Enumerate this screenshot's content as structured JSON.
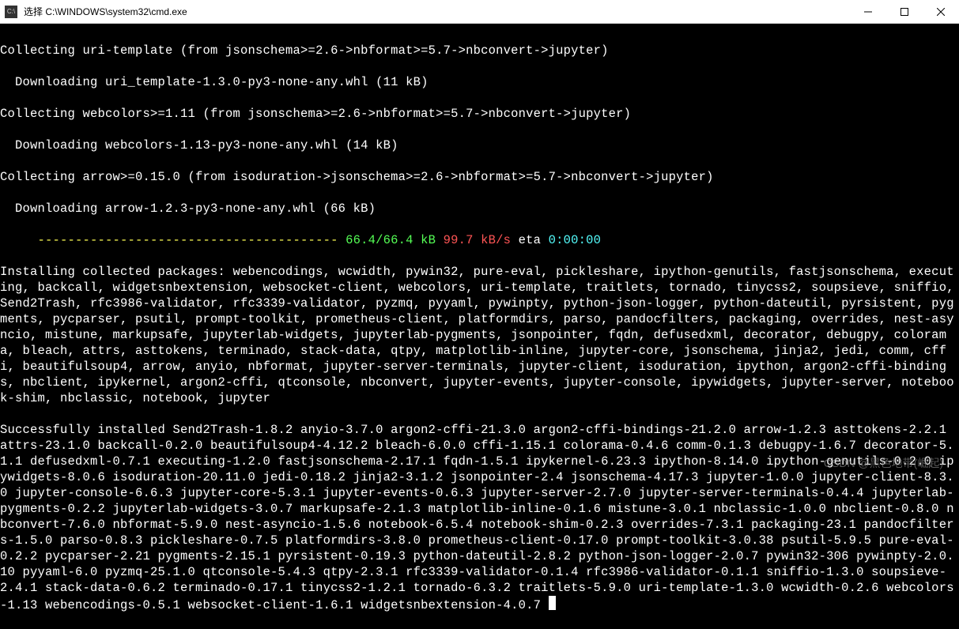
{
  "window": {
    "title": "选择 C:\\WINDOWS\\system32\\cmd.exe",
    "icon_label": "cmd"
  },
  "lines": {
    "l1": "Collecting uri-template (from jsonschema>=2.6->nbformat>=5.7->nbconvert->jupyter)",
    "l2": "  Downloading uri_template-1.3.0-py3-none-any.whl (11 kB)",
    "l3": "Collecting webcolors>=1.11 (from jsonschema>=2.6->nbformat>=5.7->nbconvert->jupyter)",
    "l4": "  Downloading webcolors-1.13-py3-none-any.whl (14 kB)",
    "l5": "Collecting arrow>=0.15.0 (from isoduration->jsonschema>=2.6->nbformat>=5.7->nbconvert->jupyter)",
    "l6": "  Downloading arrow-1.2.3-py3-none-any.whl (66 kB)",
    "progress": {
      "dashes": "     ---------------------------------------- ",
      "size": "66.4/66.4 kB",
      "speed": " 99.7 kB/s",
      "eta_label": " eta ",
      "eta_value": "0:00:00"
    },
    "install": "Installing collected packages: webencodings, wcwidth, pywin32, pure-eval, pickleshare, ipython-genutils, fastjsonschema, executing, backcall, widgetsnbextension, websocket-client, webcolors, uri-template, traitlets, tornado, tinycss2, soupsieve, sniffio, Send2Trash, rfc3986-validator, rfc3339-validator, pyzmq, pyyaml, pywinpty, python-json-logger, python-dateutil, pyrsistent, pygments, pycparser, psutil, prompt-toolkit, prometheus-client, platformdirs, parso, pandocfilters, packaging, overrides, nest-asyncio, mistune, markupsafe, jupyterlab-widgets, jupyterlab-pygments, jsonpointer, fqdn, defusedxml, decorator, debugpy, colorama, bleach, attrs, asttokens, terminado, stack-data, qtpy, matplotlib-inline, jupyter-core, jsonschema, jinja2, jedi, comm, cffi, beautifulsoup4, arrow, anyio, nbformat, jupyter-server-terminals, jupyter-client, isoduration, ipython, argon2-cffi-bindings, nbclient, ipykernel, argon2-cffi, qtconsole, nbconvert, jupyter-events, jupyter-console, ipywidgets, jupyter-server, notebook-shim, nbclassic, notebook, jupyter",
    "success": "Successfully installed Send2Trash-1.8.2 anyio-3.7.0 argon2-cffi-21.3.0 argon2-cffi-bindings-21.2.0 arrow-1.2.3 asttokens-2.2.1 attrs-23.1.0 backcall-0.2.0 beautifulsoup4-4.12.2 bleach-6.0.0 cffi-1.15.1 colorama-0.4.6 comm-0.1.3 debugpy-1.6.7 decorator-5.1.1 defusedxml-0.7.1 executing-1.2.0 fastjsonschema-2.17.1 fqdn-1.5.1 ipykernel-6.23.3 ipython-8.14.0 ipython-genutils-0.2.0 ipywidgets-8.0.6 isoduration-20.11.0 jedi-0.18.2 jinja2-3.1.2 jsonpointer-2.4 jsonschema-4.17.3 jupyter-1.0.0 jupyter-client-8.3.0 jupyter-console-6.6.3 jupyter-core-5.3.1 jupyter-events-0.6.3 jupyter-server-2.7.0 jupyter-server-terminals-0.4.4 jupyterlab-pygments-0.2.2 jupyterlab-widgets-3.0.7 markupsafe-2.1.3 matplotlib-inline-0.1.6 mistune-3.0.1 nbclassic-1.0.0 nbclient-0.8.0 nbconvert-7.6.0 nbformat-5.9.0 nest-asyncio-1.5.6 notebook-6.5.4 notebook-shim-0.2.3 overrides-7.3.1 packaging-23.1 pandocfilters-1.5.0 parso-0.8.3 pickleshare-0.7.5 platformdirs-3.8.0 prometheus-client-0.17.0 prompt-toolkit-3.0.38 psutil-5.9.5 pure-eval-0.2.2 pycparser-2.21 pygments-2.15.1 pyrsistent-0.19.3 python-dateutil-2.8.2 python-json-logger-2.0.7 pywin32-306 pywinpty-2.0.10 pyyaml-6.0 pyzmq-25.1.0 qtconsole-5.4.3 qtpy-2.3.1 rfc3339-validator-0.1.4 rfc3986-validator-0.1.1 sniffio-1.3.0 soupsieve-2.4.1 stack-data-0.6.2 terminado-0.17.1 tinycss2-1.2.1 tornado-6.3.2 traitlets-5.9.0 uri-template-1.3.0 wcwidth-0.2.6 webcolors-1.13 webencodings-0.5.1 websocket-client-1.6.1 widgetsnbextension-4.0.7"
  },
  "watermark": "CSDN @黑色地带(崛起)"
}
